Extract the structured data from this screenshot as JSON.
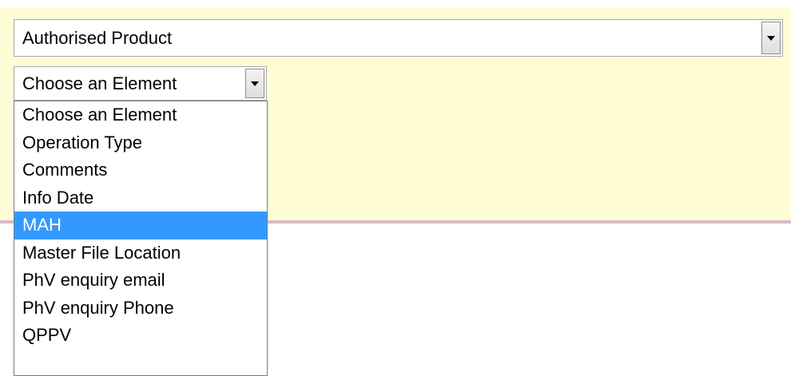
{
  "product_select": {
    "value": "Authorised Product"
  },
  "element_select": {
    "value": "Choose an Element",
    "options": [
      "Choose an Element",
      "Operation Type",
      "Comments",
      "Info Date",
      "MAH",
      "Master File Location",
      "PhV enquiry email",
      "PhV enquiry Phone",
      "QPPV"
    ],
    "highlighted_option": "MAH"
  },
  "colors": {
    "panel_background": "#fffdd6",
    "selection_highlight": "#3399ff",
    "panel_border": "#d8b9c9"
  }
}
